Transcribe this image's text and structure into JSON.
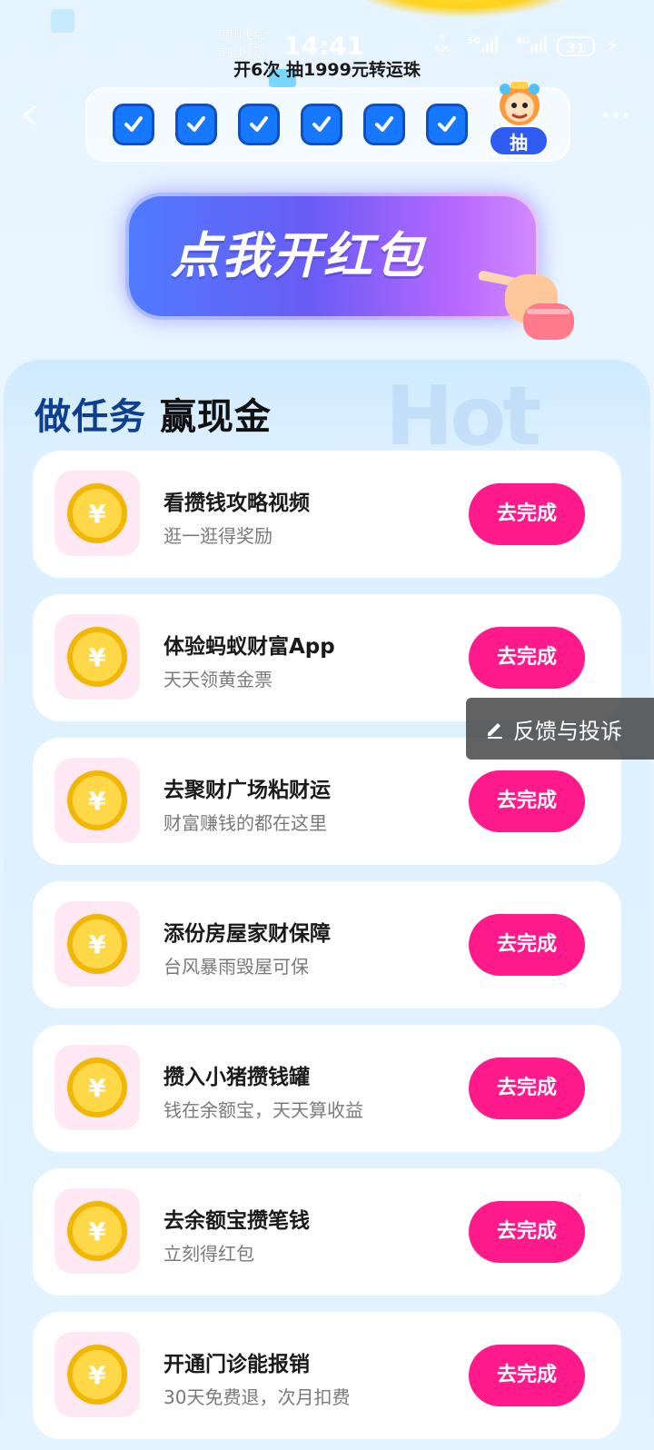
{
  "status_bar": {
    "carrier_line1": "中国电信",
    "carrier_line2": "中国移动",
    "time": "14:41",
    "net_speed_value": "4",
    "net_speed_unit": "K/s",
    "signal1_label": "5G",
    "signal2_label": "4G",
    "battery": "31"
  },
  "header": {
    "draw_caption": "开6次 抽1999元转运珠",
    "checks_completed": 6,
    "checks_total": 6,
    "draw_badge": "抽"
  },
  "open_button": {
    "label": "点我开红包"
  },
  "panel": {
    "title_part1": "做任务",
    "title_part2": "赢现金",
    "bg_text": "Hot"
  },
  "tasks": [
    {
      "title": "看攒钱攻略视频",
      "subtitle": "逛一逛得奖励",
      "button": "去完成"
    },
    {
      "title": "体验蚂蚁财富App",
      "subtitle": "天天领黄金票",
      "button": "去完成"
    },
    {
      "title": "去聚财广场粘财运",
      "subtitle": "财富赚钱的都在这里",
      "button": "去完成"
    },
    {
      "title": "添份房屋家财保障",
      "subtitle": "台风暴雨毁屋可保",
      "button": "去完成"
    },
    {
      "title": "攒入小猪攒钱罐",
      "subtitle": "钱在余额宝，天天算收益",
      "button": "去完成"
    },
    {
      "title": "去余额宝攒笔钱",
      "subtitle": "立刻得红包",
      "button": "去完成"
    },
    {
      "title": "开通门诊能报销",
      "subtitle": "30天免费退，次月扣费",
      "button": "去完成"
    }
  ],
  "feedback": {
    "label": "反馈与投诉"
  },
  "colors": {
    "accent_pink": "#ff1a8c",
    "check_blue": "#1677ff",
    "title_blue": "#0e3f8f"
  },
  "icons": [
    "back-icon",
    "more-icon",
    "check-icon",
    "mascot-icon",
    "pointing-hand-icon",
    "coin-icon",
    "edit-icon"
  ]
}
